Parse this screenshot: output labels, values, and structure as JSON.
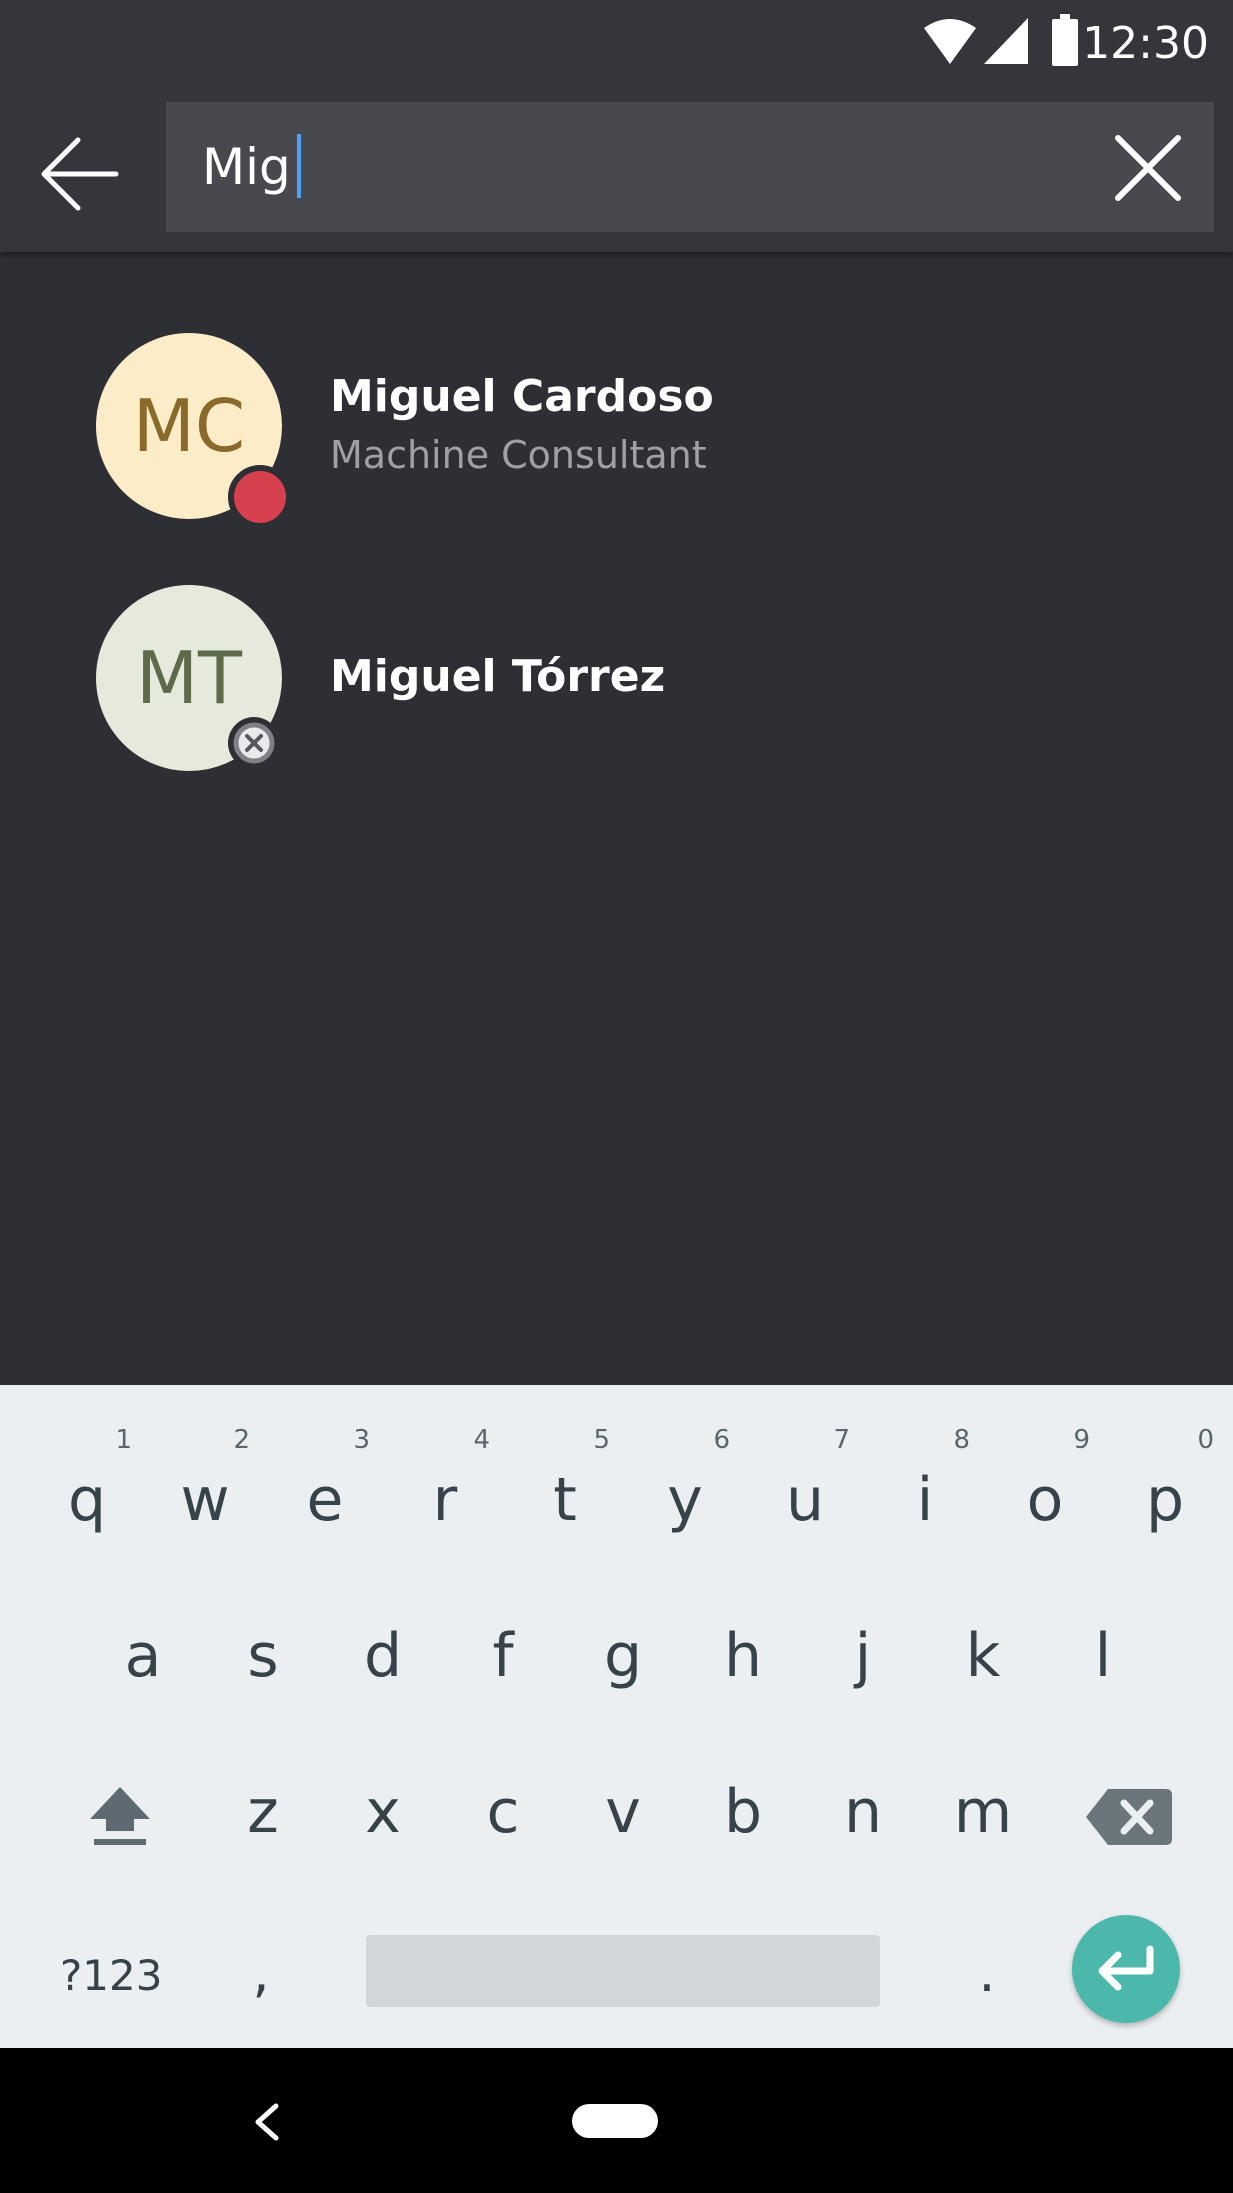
{
  "status_bar": {
    "time": "12:30",
    "icons": [
      "wifi-icon",
      "signal-icon",
      "battery-icon"
    ]
  },
  "search": {
    "query": "Mig",
    "back_icon": "arrow-left-icon",
    "clear_icon": "close-icon"
  },
  "results": [
    {
      "initials": "MC",
      "name": "Miguel Cardoso",
      "title": "Machine Consultant",
      "avatar_bg": "#fcecc8",
      "initials_color": "#8a6a2a",
      "presence": "busy",
      "presence_color": "#d6404f"
    },
    {
      "initials": "MT",
      "name": "Miguel Tórrez",
      "title": "",
      "avatar_bg": "#e6eadd",
      "initials_color": "#5d6b4a",
      "presence": "offline",
      "presence_color": "#9aa0a6"
    }
  ],
  "keyboard": {
    "row1": [
      {
        "k": "q",
        "h": "1"
      },
      {
        "k": "w",
        "h": "2"
      },
      {
        "k": "e",
        "h": "3"
      },
      {
        "k": "r",
        "h": "4"
      },
      {
        "k": "t",
        "h": "5"
      },
      {
        "k": "y",
        "h": "6"
      },
      {
        "k": "u",
        "h": "7"
      },
      {
        "k": "i",
        "h": "8"
      },
      {
        "k": "o",
        "h": "9"
      },
      {
        "k": "p",
        "h": "0"
      }
    ],
    "row2": [
      "a",
      "s",
      "d",
      "f",
      "g",
      "h",
      "j",
      "k",
      "l"
    ],
    "row3": [
      "z",
      "x",
      "c",
      "v",
      "b",
      "n",
      "m"
    ],
    "symbols_label": "?123",
    "comma": ",",
    "period": ".",
    "accent": "#4bb8ab"
  },
  "nav_bar": {
    "back_icon": "nav-back-icon",
    "home_icon": "nav-home-icon"
  }
}
